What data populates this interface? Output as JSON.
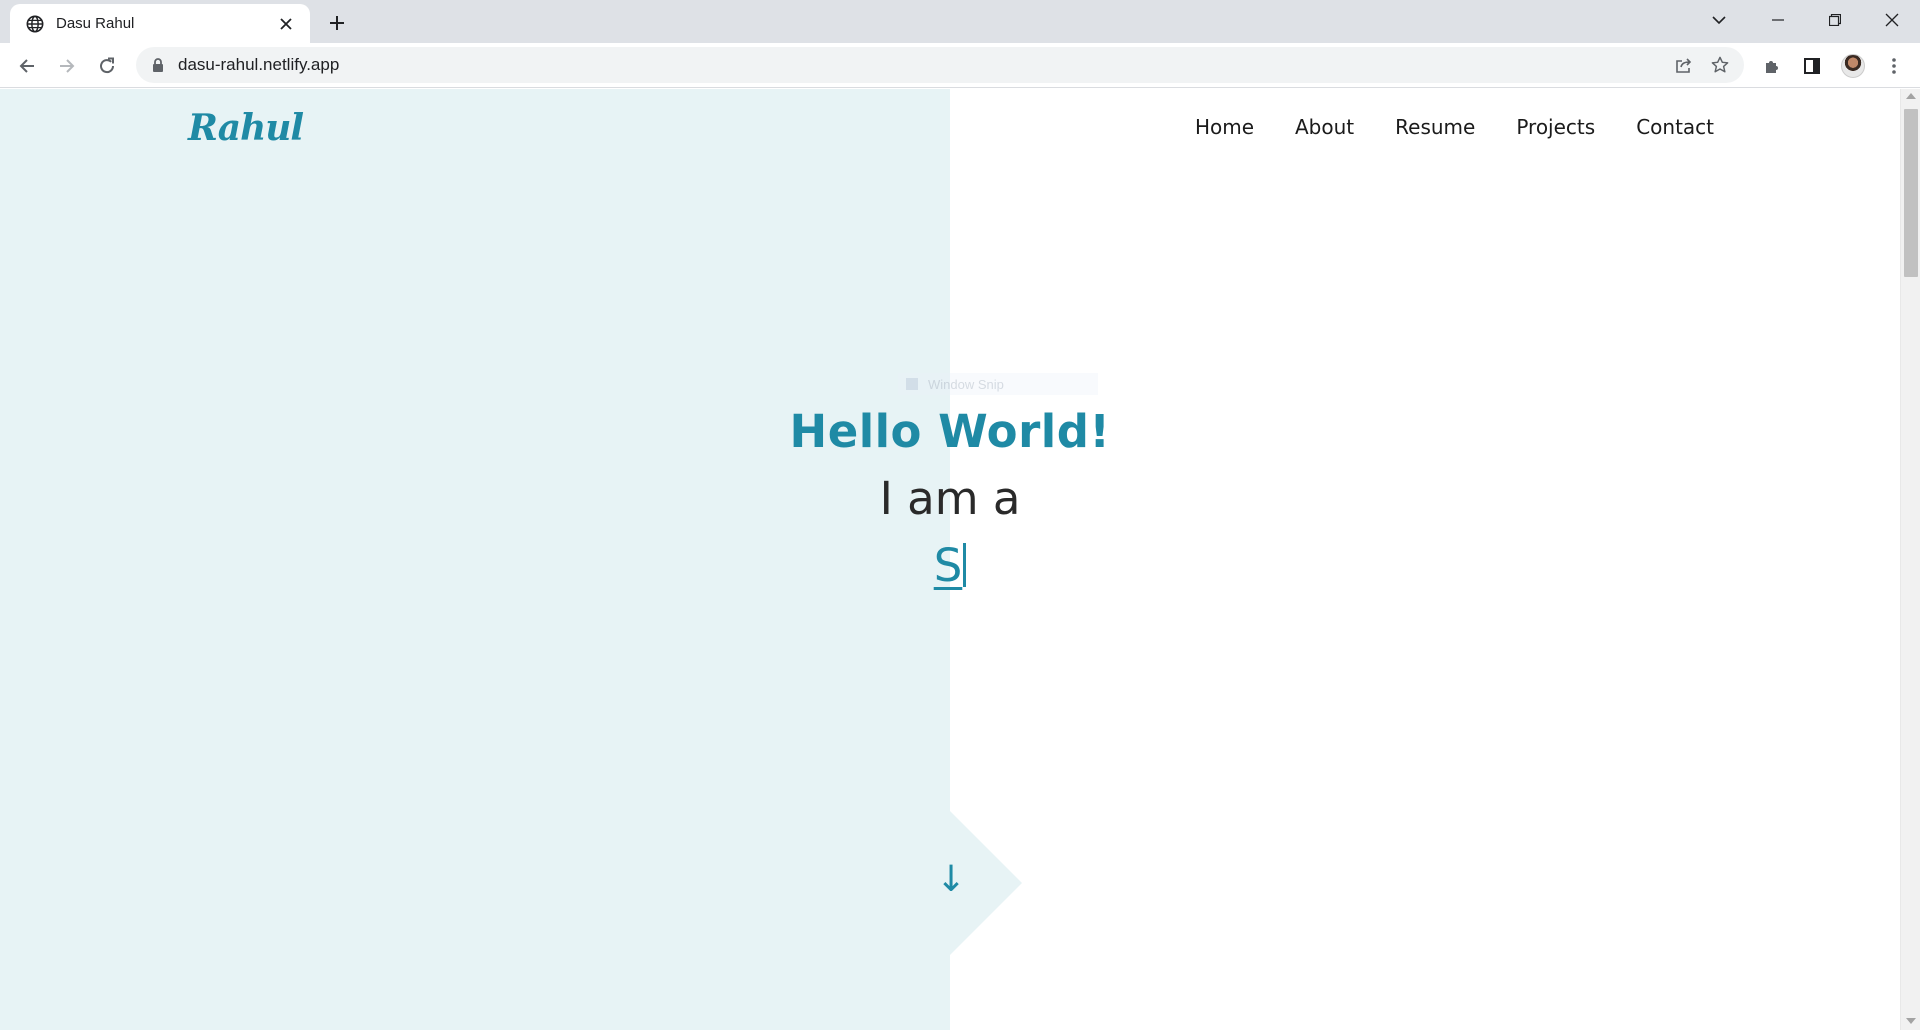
{
  "browser": {
    "tab": {
      "title": "Dasu Rahul",
      "favicon": "globe-icon"
    },
    "new_tab": "plus-icon",
    "address": {
      "url": "dasu-rahul.netlify.app",
      "lock": "lock-icon"
    },
    "toolbar_icons": [
      "back-icon",
      "forward-icon",
      "reload-icon",
      "share-icon",
      "star-icon",
      "extensions-icon",
      "side-panel-icon",
      "avatar",
      "menu-icon"
    ]
  },
  "site": {
    "logo": "Rahul",
    "nav": {
      "home": "Home",
      "about": "About",
      "resume": "Resume",
      "projects": "Projects",
      "contact": "Contact"
    },
    "hero": {
      "greeting": "Hello World!",
      "intro": "I am a",
      "typed": "S",
      "scroll_arrow": "↓"
    },
    "ghost_tooltip": "Window Snip"
  },
  "colors": {
    "accent": "#1f8aa5",
    "hero_bg": "#e7f3f5",
    "text_dark": "#2a2a2a"
  }
}
